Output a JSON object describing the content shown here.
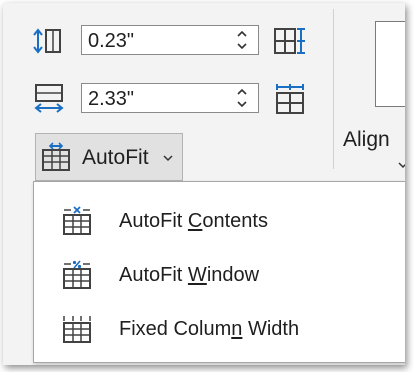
{
  "cell_size": {
    "height_field": {
      "value": "0.23\"",
      "icon": "row-height-icon",
      "side_icon": "distribute-rows-icon"
    },
    "width_field": {
      "value": "2.33\"",
      "icon": "column-width-icon",
      "side_icon": "distribute-columns-icon"
    },
    "autofit_button": {
      "label": "AutoFit",
      "icon": "autofit-icon"
    }
  },
  "alignment": {
    "label": "Align"
  },
  "autofit_menu": {
    "items": [
      {
        "pre": "AutoFit ",
        "key": "C",
        "post": "ontents",
        "icon": "autofit-contents-icon"
      },
      {
        "pre": "AutoFit ",
        "key": "W",
        "post": "indow",
        "icon": "autofit-window-icon"
      },
      {
        "pre": "Fixed Colum",
        "key": "n",
        "post": " Width",
        "icon": "fixed-column-width-icon"
      }
    ]
  },
  "colors": {
    "icon_blue": "#1a6fc4",
    "icon_dark": "#424242",
    "ribbon_bg": "#f3f3f3",
    "button_bg": "#e1e1e1"
  }
}
